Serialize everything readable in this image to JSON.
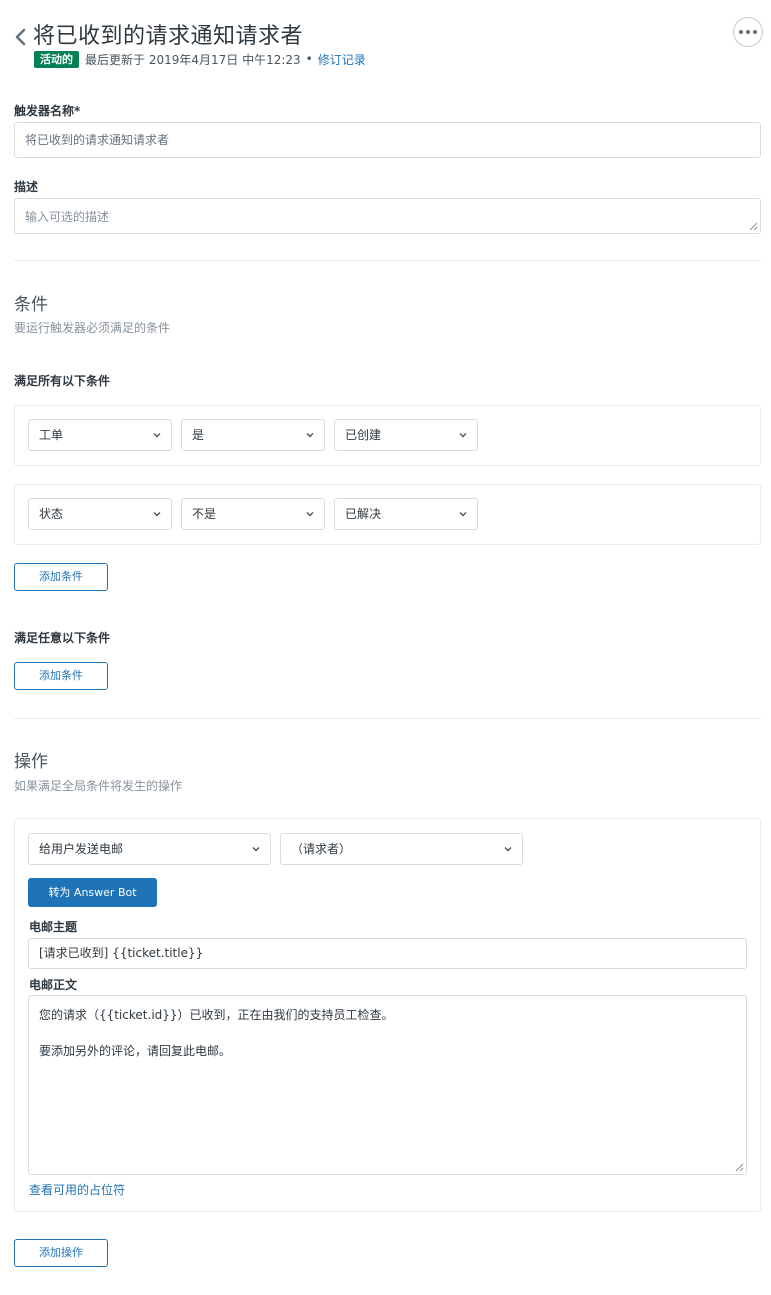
{
  "header": {
    "title": "将已收到的请求通知请求者",
    "status_badge": "活动的",
    "last_updated": "最后更新于 2019年4月17日 中午12:23",
    "dot": "•",
    "revision_link": "修订记录"
  },
  "fields": {
    "name_label": "触发器名称*",
    "name_value": "将已收到的请求通知请求者",
    "description_label": "描述",
    "description_placeholder": "输入可选的描述"
  },
  "conditions": {
    "title": "条件",
    "subtitle": "要运行触发器必须满足的条件",
    "all_label": "满足所有以下条件",
    "all_rows": [
      {
        "field": "工单",
        "operator": "是",
        "value": "已创建"
      },
      {
        "field": "状态",
        "operator": "不是",
        "value": "已解决"
      }
    ],
    "add_condition_all": "添加条件",
    "any_label": "满足任意以下条件",
    "add_condition_any": "添加条件"
  },
  "actions": {
    "title": "操作",
    "subtitle": "如果满足全局条件将发生的操作",
    "action_select": "给用户发送电邮",
    "recipient_select": "（请求者）",
    "answer_bot_button": "转为 Answer Bot",
    "email_subject_label": "电邮主题",
    "email_subject_value": "[请求已收到] {{ticket.title}}",
    "email_body_label": "电邮正文",
    "email_body_line1": "您的请求（{{ticket.id}}）已收到，正在由我们的支持员工检查。",
    "email_body_line2": "要添加另外的评论，请回复此电邮。",
    "placeholders_link": "查看可用的占位符",
    "add_action": "添加操作"
  },
  "colors": {
    "accent": "#1f73b7",
    "active_badge": "#038153"
  }
}
